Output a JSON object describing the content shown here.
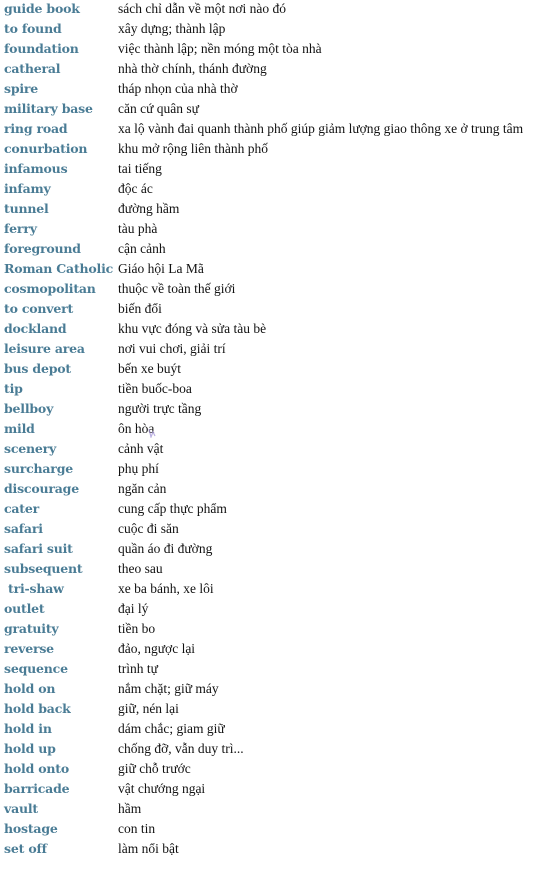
{
  "vocabulary": [
    {
      "term": "guide book",
      "definition": "sách chỉ dẫn về một nơi nào đó"
    },
    {
      "term": "to found",
      "definition": "xây dựng; thành lập"
    },
    {
      "term": "foundation",
      "definition": "việc thành lập; nền móng một tòa nhà"
    },
    {
      "term": "catheral",
      "definition": "nhà thờ chính, thánh đường"
    },
    {
      "term": "spire",
      "definition": "tháp nhọn của nhà thờ"
    },
    {
      "term": "military base",
      "definition": "căn cứ quân sự"
    },
    {
      "term": "ring road",
      "definition": "xa lộ vành đai quanh thành phố giúp giảm lượng giao thông xe ở trung tâm"
    },
    {
      "term": "conurbation",
      "definition": "khu mở rộng liên thành phố"
    },
    {
      "term": "infamous",
      "definition": "tai tiếng"
    },
    {
      "term": "infamy",
      "definition": "độc ác"
    },
    {
      "term": "tunnel",
      "definition": "đường hầm"
    },
    {
      "term": "ferry",
      "definition": "tàu phà"
    },
    {
      "term": "foreground",
      "definition": "cận cảnh"
    },
    {
      "term": "Roman Catholic",
      "definition": "Giáo hội La Mã"
    },
    {
      "term": "cosmopolitan",
      "definition": "thuộc về toàn thế giới"
    },
    {
      "term": "to convert",
      "definition": "biến đổi"
    },
    {
      "term": "dockland",
      "definition": "khu vực đóng và sửa tàu bè"
    },
    {
      "term": "leisure area",
      "definition": "nơi vui chơi, giải trí"
    },
    {
      "term": "bus depot",
      "definition": "bến xe buýt"
    },
    {
      "term": "tip",
      "definition": "tiền buốc-boa"
    },
    {
      "term": "bellboy",
      "definition": "người trực tầng"
    },
    {
      "term": "mild",
      "definition": "ôn hòa"
    },
    {
      "term": "scenery",
      "definition": "cảnh vật"
    },
    {
      "term": "surcharge",
      "definition": "phụ phí"
    },
    {
      "term": "discourage",
      "definition": "ngăn cản"
    },
    {
      "term": "cater",
      "definition": "cung cấp thực phẩm"
    },
    {
      "term": "safari",
      "definition": "cuộc đi săn"
    },
    {
      "term": "safari suit",
      "definition": "quần áo đi đường"
    },
    {
      "term": "subsequent",
      "definition": "theo sau"
    },
    {
      "term": "tri-shaw",
      "definition": "xe ba bánh, xe lôi"
    },
    {
      "term": "outlet",
      "definition": "đại lý"
    },
    {
      "term": "gratuity",
      "definition": "tiền bo"
    },
    {
      "term": "reverse",
      "definition": "đảo, ngược lại"
    },
    {
      "term": "sequence",
      "definition": "trình tự"
    },
    {
      "term": "hold on",
      "definition": "nắm chặt; giữ máy"
    },
    {
      "term": "hold back",
      "definition": "giữ, nén lại"
    },
    {
      "term": "hold in",
      "definition": "dám chắc; giam giữ"
    },
    {
      "term": "hold up",
      "definition": "chống đỡ, vẫn duy trì..."
    },
    {
      "term": "hold onto",
      "definition": "giữ chỗ trước"
    },
    {
      "term": "barricade",
      "definition": "vật chướng ngại"
    },
    {
      "term": "vault",
      "definition": "hầm"
    },
    {
      "term": "hostage",
      "definition": "con tin"
    },
    {
      "term": "set off",
      "definition": "làm nổi bật"
    }
  ],
  "colors": {
    "term": "#4a7c95",
    "definition": "#111111",
    "background": "#ffffff"
  }
}
